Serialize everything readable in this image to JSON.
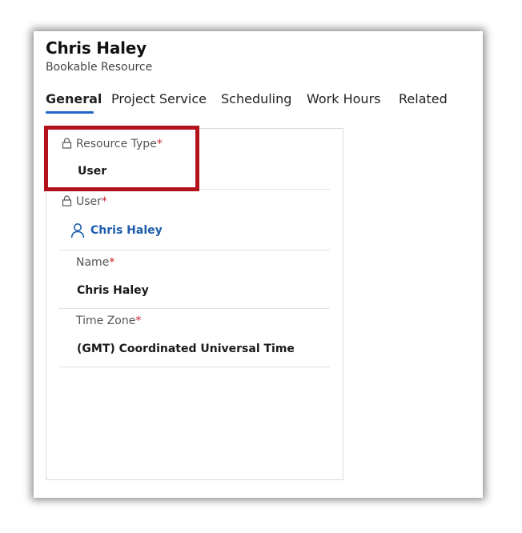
{
  "record": {
    "title": "Chris Haley",
    "entity": "Bookable Resource"
  },
  "tabs": [
    {
      "label": "General",
      "active": true
    },
    {
      "label": "Project Service",
      "active": false
    },
    {
      "label": "Scheduling",
      "active": false
    },
    {
      "label": "Work Hours",
      "active": false
    },
    {
      "label": "Related",
      "active": false
    }
  ],
  "fields": {
    "resource_type": {
      "label": "Resource Type",
      "required": "*",
      "value": "User",
      "locked": true
    },
    "user": {
      "label": "User",
      "required": "*",
      "value": "Chris Haley",
      "locked": true
    },
    "name": {
      "label": "Name",
      "required": "*",
      "value": "Chris Haley"
    },
    "time_zone": {
      "label": "Time Zone",
      "required": "*",
      "value": "(GMT) Coordinated Universal Time"
    }
  },
  "colors": {
    "tab_indicator": "#2266c9",
    "required_marker": "#c4262e",
    "link": "#1f5dad",
    "highlight": "#b1121c"
  },
  "icons": {
    "lock": "lock-icon",
    "person": "person-icon"
  }
}
